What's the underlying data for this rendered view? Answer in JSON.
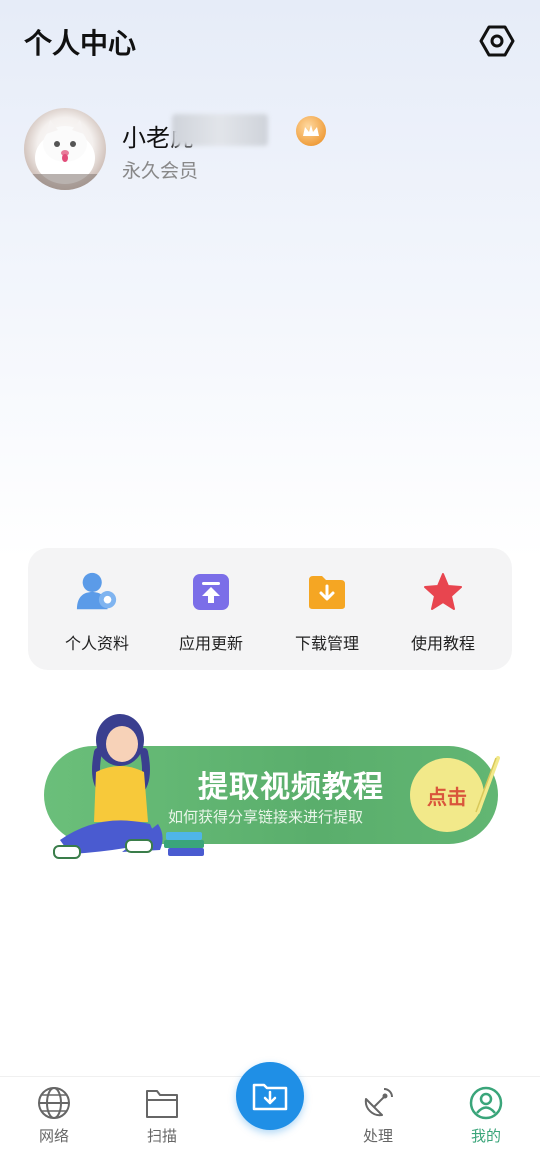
{
  "header": {
    "title": "个人中心",
    "settings_icon": "gear-hexagon-icon"
  },
  "profile": {
    "username": "小老虎",
    "membership": "永久会员",
    "badge_icon": "crown-icon"
  },
  "menu": {
    "items": [
      {
        "label": "个人资料",
        "icon": "user-profile-icon",
        "color": "#4a90e2"
      },
      {
        "label": "应用更新",
        "icon": "upload-arrow-icon",
        "color": "#7b6ee8"
      },
      {
        "label": "下载管理",
        "icon": "download-folder-icon",
        "color": "#f5a623"
      },
      {
        "label": "使用教程",
        "icon": "star-icon",
        "color": "#e8454f"
      }
    ]
  },
  "banner": {
    "title": "提取视频教程",
    "subtitle": "如何获得分享链接来进行提取",
    "button_label": "点击"
  },
  "bottom_nav": {
    "tabs": [
      {
        "label": "网络",
        "icon": "globe-icon"
      },
      {
        "label": "扫描",
        "icon": "folder-icon"
      },
      {
        "label": "处理",
        "icon": "satellite-dish-icon"
      },
      {
        "label": "我的",
        "icon": "user-circle-icon",
        "active": true
      }
    ],
    "center_icon": "download-folder-icon",
    "accent_color": "#3aa57a",
    "center_color": "#1f8fe6"
  }
}
